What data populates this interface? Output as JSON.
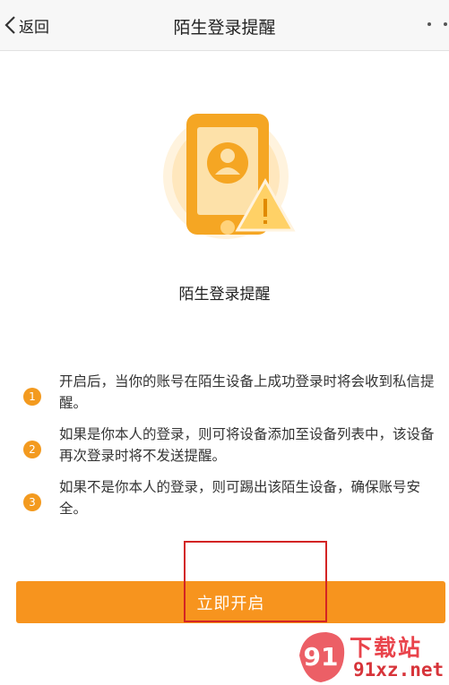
{
  "nav": {
    "back_label": "返回",
    "title": "陌生登录提醒"
  },
  "hero": {
    "title": "陌生登录提醒"
  },
  "tips": [
    {
      "num": "1",
      "text": "开启后，当你的账号在陌生设备上成功登录时将会收到私信提醒。"
    },
    {
      "num": "2",
      "text": "如果是你本人的登录，则可将设备添加至设备列表中，该设备再次登录时将不发送提醒。"
    },
    {
      "num": "3",
      "text": "如果不是你本人的登录，则可踢出该陌生设备，确保账号安全。"
    }
  ],
  "action": {
    "enable_label": "立即开启"
  },
  "watermark": {
    "brand": "下载站",
    "domain": "91xz.net",
    "logo_text": "91"
  },
  "colors": {
    "accent": "#f7941e",
    "highlight_box": "#d32424",
    "watermark": "#e9434b"
  }
}
